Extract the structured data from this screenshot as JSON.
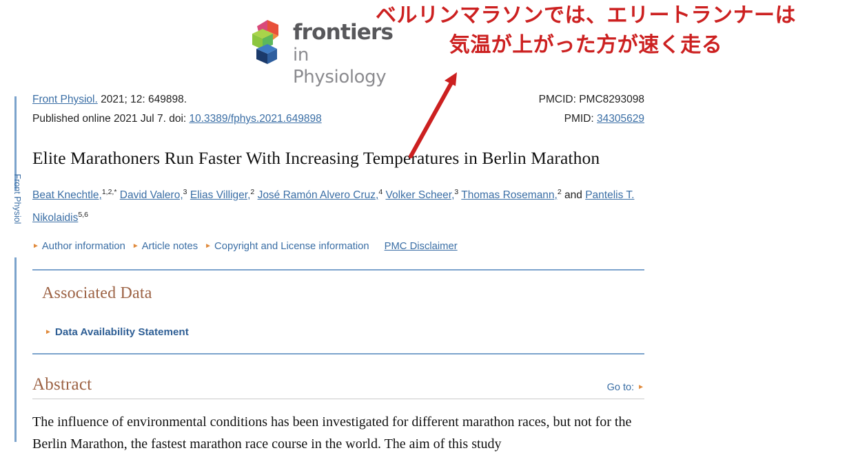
{
  "annotation": {
    "text": "ベルリンマラソンでは、エリートランナーは\n気温が上がった方が速く走る",
    "color": "#cc2020",
    "arrow_icon": "red-arrow-icon"
  },
  "logo": {
    "mark_icon": "frontiers-cubes-logo-icon",
    "line1": "frontiers",
    "line2": "in Physiology"
  },
  "rail": {
    "label": "Front Physiol"
  },
  "citation": {
    "journal": "Front Physiol.",
    "volume_info": " 2021; 12: 649898.",
    "published_label": "Published online 2021 Jul 7. doi: ",
    "doi": "10.3389/fphys.2021.649898",
    "pmcid": "PMCID: PMC8293098",
    "pmid_label": "PMID: ",
    "pmid": "34305629"
  },
  "article": {
    "title": "Elite Marathoners Run Faster With Increasing Temperatures in Berlin Marathon",
    "authors": [
      {
        "name": "Beat Knechtle,",
        "sup": "1,2,*"
      },
      {
        "name": "David Valero,",
        "sup": "3"
      },
      {
        "name": "Elias Villiger,",
        "sup": "2"
      },
      {
        "name": "José Ramón Alvero Cruz,",
        "sup": "4"
      },
      {
        "name": "Volker Scheer,",
        "sup": "3"
      },
      {
        "name": "Thomas Rosemann,",
        "sup": "2"
      },
      {
        "name": "Pantelis T. Nikolaidis",
        "sup": "5,6"
      }
    ],
    "authors_conjunction": "and",
    "links": [
      {
        "label": "Author information",
        "bullet": true,
        "underline": false
      },
      {
        "label": "Article notes",
        "bullet": true,
        "underline": false
      },
      {
        "label": "Copyright and License information",
        "bullet": true,
        "underline": false
      },
      {
        "label": "PMC Disclaimer",
        "bullet": false,
        "underline": true
      }
    ]
  },
  "associated_data": {
    "heading": "Associated Data",
    "items": [
      {
        "label": "Data Availability Statement"
      }
    ]
  },
  "abstract": {
    "heading": "Abstract",
    "goto_label": "Go to:",
    "line1": "The influence of environmental conditions has been investigated for different marathon races, but",
    "line2": "not for the Berlin Marathon, the fastest marathon race course in the world. The aim of this study"
  },
  "colors": {
    "rule_blue": "#7ba3cc",
    "link_blue": "#3a6ea5",
    "section_brown": "#9c6244",
    "triangle_orange": "#e08a3c",
    "annotation_red": "#cc2020"
  }
}
